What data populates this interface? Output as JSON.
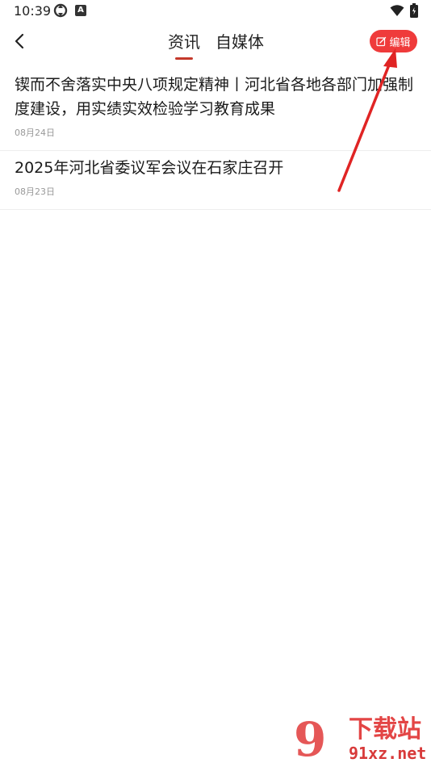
{
  "status_bar": {
    "time": "10:39",
    "icons": [
      "sync-icon",
      "a-icon",
      "wifi-icon",
      "battery-icon"
    ],
    "a_badge": "A"
  },
  "header": {
    "back_icon": "chevron-left-icon",
    "tabs": [
      {
        "label": "资讯",
        "active": true
      },
      {
        "label": "自媒体",
        "active": false
      }
    ],
    "edit_button": {
      "label": "编辑",
      "icon": "edit-icon"
    },
    "accent_color": "#c4392b",
    "button_color": "#ef3b3b"
  },
  "news": [
    {
      "title": "锲而不舍落实中央八项规定精神丨河北省各地各部门加强制度建设，用实绩实效检验学习教育成果",
      "date": "08月24日"
    },
    {
      "title": "2025年河北省委议军会议在石家庄召开",
      "date": "08月23日"
    }
  ],
  "watermark": {
    "logo_glyph": "9",
    "title": "下载站",
    "site": "91xz.net"
  }
}
